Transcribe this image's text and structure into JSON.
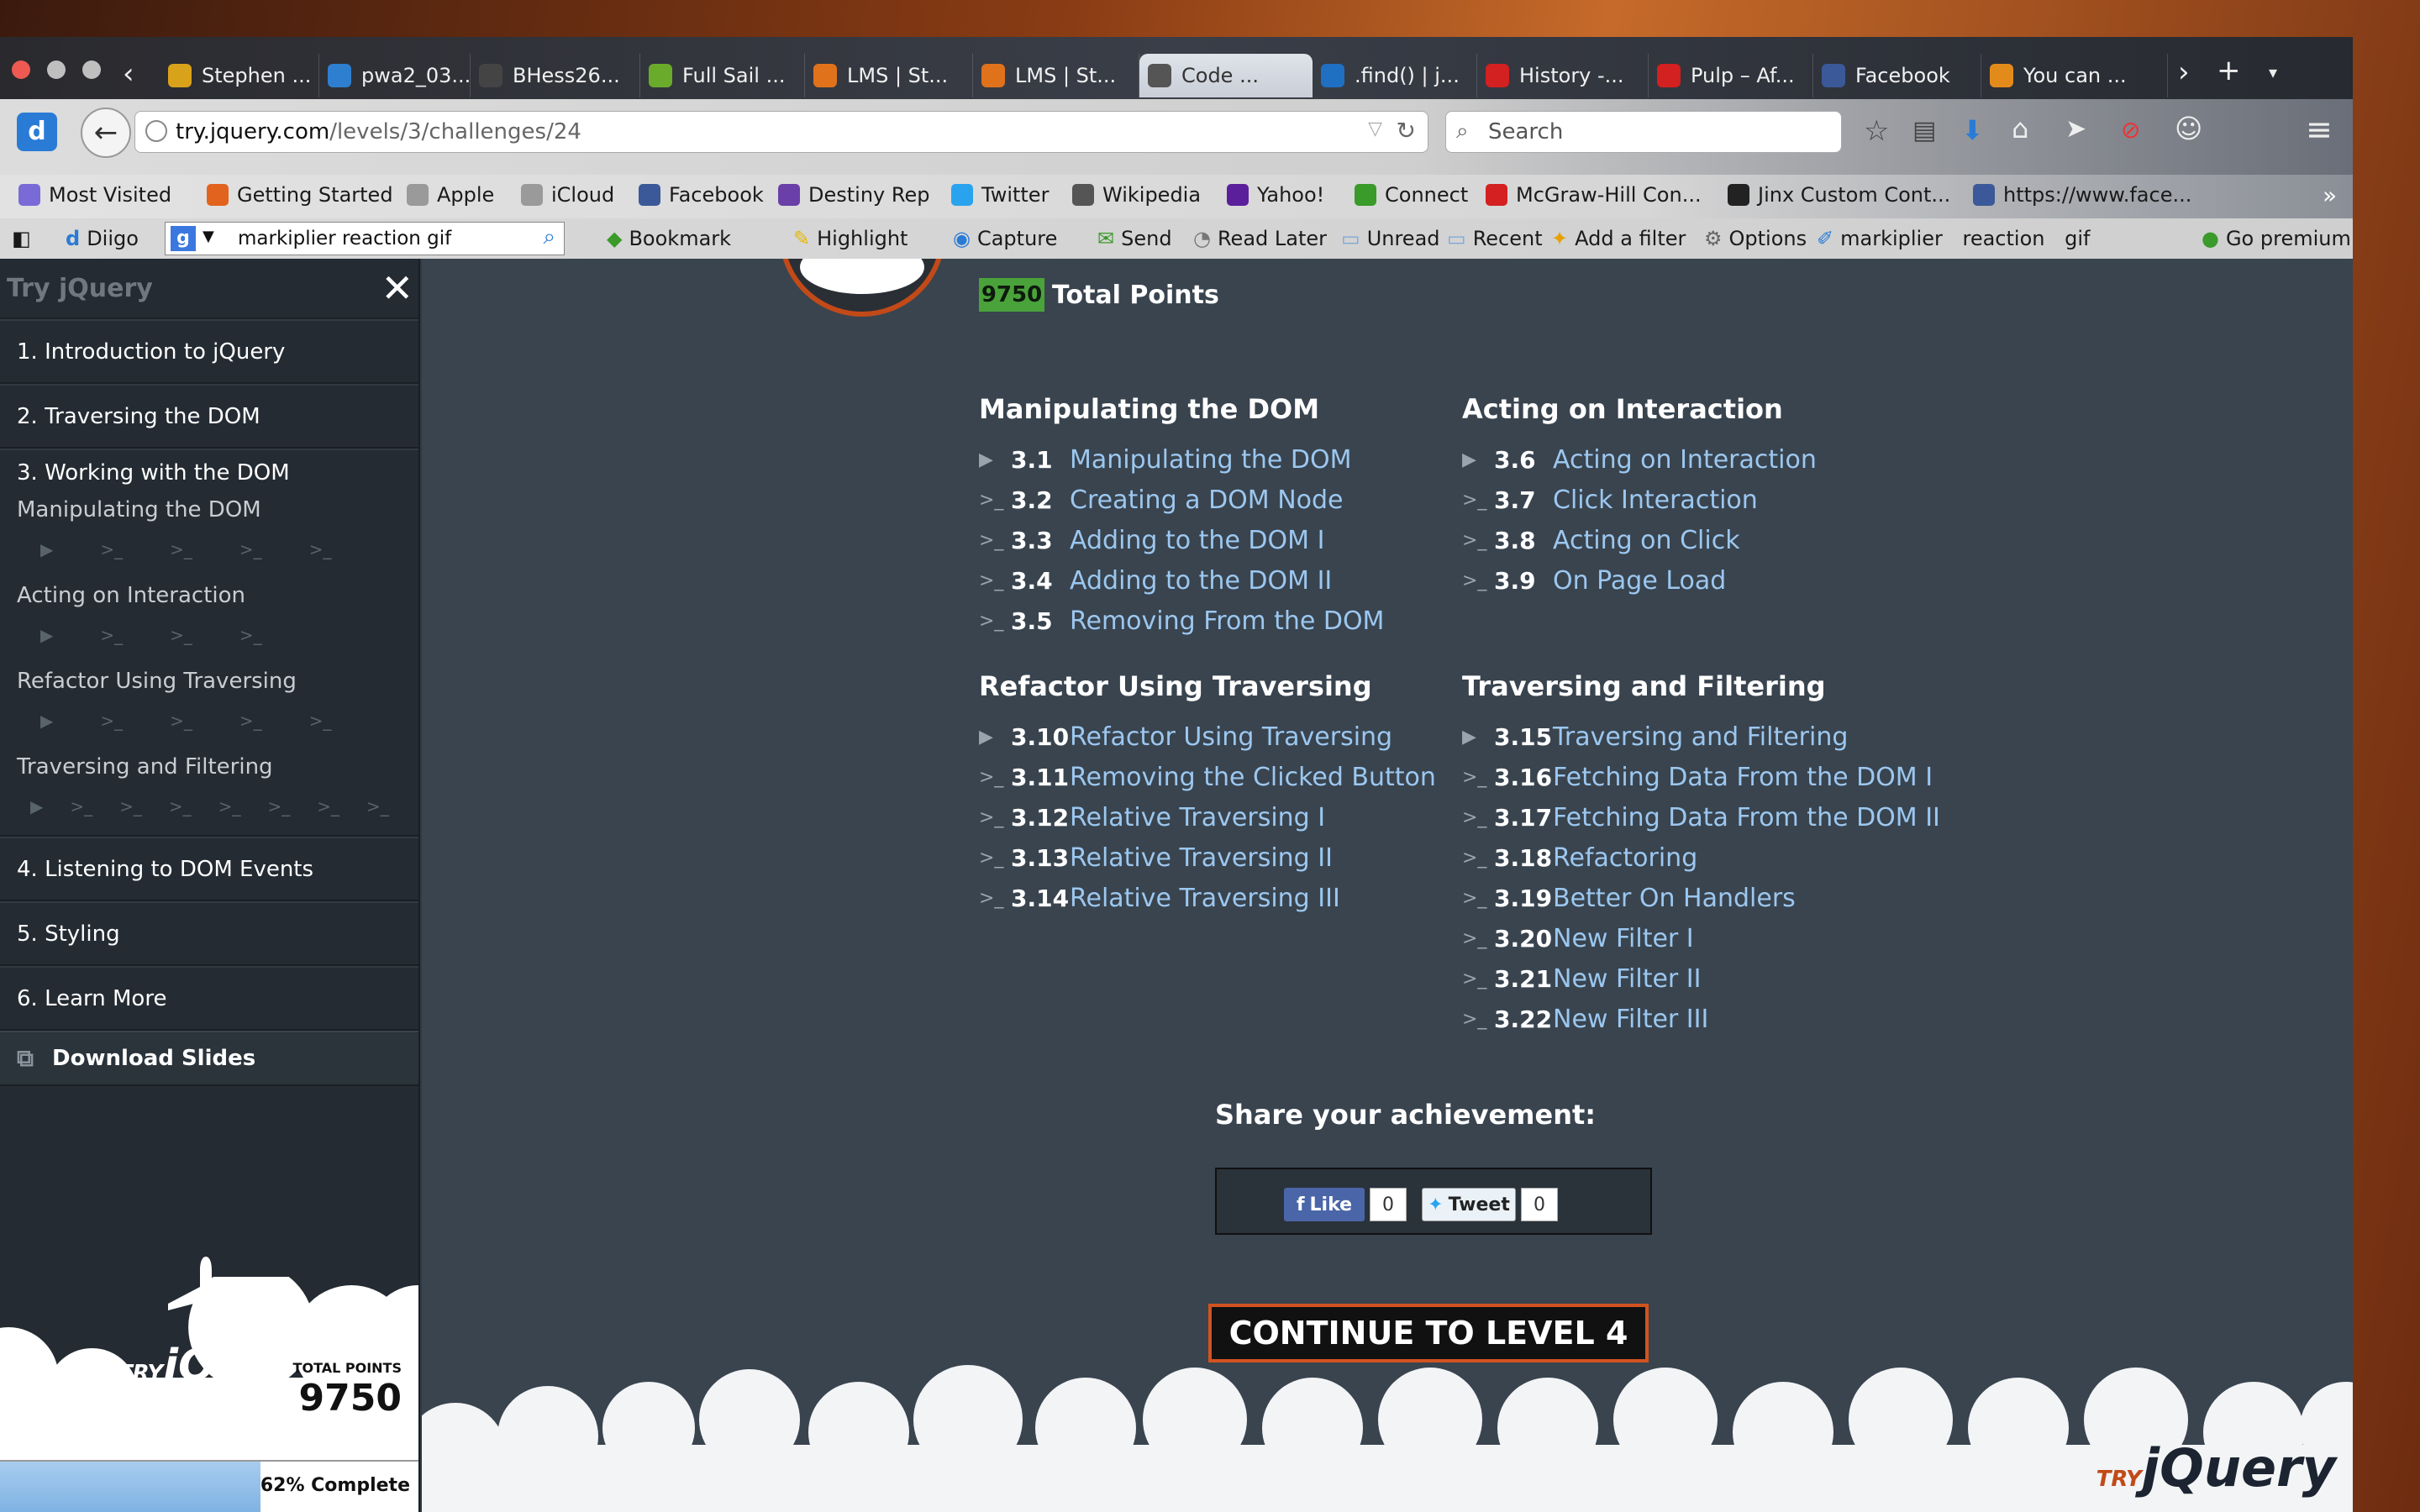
{
  "browser": {
    "tabs": [
      {
        "label": "Stephen ...",
        "icon": "b-icon",
        "color": "#d9a21b"
      },
      {
        "label": "pwa2_03...",
        "icon": "eye-icon",
        "color": "#2e7fd0"
      },
      {
        "label": "BHess26...",
        "icon": "github-icon",
        "color": "#444444"
      },
      {
        "label": "Full Sail ...",
        "icon": "fullsail-icon",
        "color": "#6bab2c"
      },
      {
        "label": "LMS | St...",
        "icon": "lms-icon",
        "color": "#e0721c"
      },
      {
        "label": "LMS | St...",
        "icon": "lms-icon",
        "color": "#e0721c"
      },
      {
        "label": "Code ...",
        "icon": "code-icon",
        "color": "#555555"
      },
      {
        "label": ".find() | j...",
        "icon": "jquery-icon",
        "color": "#1f6fc2"
      },
      {
        "label": "History -...",
        "icon": "youtube-icon",
        "color": "#d32020"
      },
      {
        "label": "Pulp – Af...",
        "icon": "youtube-icon",
        "color": "#d32020"
      },
      {
        "label": "Facebook",
        "icon": "facebook-icon",
        "color": "#3b5998"
      },
      {
        "label": "You can ...",
        "icon": "up-icon",
        "color": "#e38b1a"
      }
    ],
    "url_domain": "try.jquery.com",
    "url_path": "/levels/3/challenges/24",
    "search_placeholder": "Search",
    "bookmarks": [
      {
        "label": "Most Visited",
        "color": "#7a6ad8"
      },
      {
        "label": "Getting Started",
        "color": "#e2631d"
      },
      {
        "label": "Apple",
        "color": "#9a9a9a"
      },
      {
        "label": "iCloud",
        "color": "#9a9a9a"
      },
      {
        "label": "Facebook",
        "color": "#3b5998"
      },
      {
        "label": "Destiny Rep",
        "color": "#6a3fa8"
      },
      {
        "label": "Twitter",
        "color": "#2aa3ef"
      },
      {
        "label": "Wikipedia",
        "color": "#555555"
      },
      {
        "label": "Yahoo!",
        "color": "#5b1f9c"
      },
      {
        "label": "Connect",
        "color": "#3a9a2a"
      },
      {
        "label": "McGraw-Hill Con...",
        "color": "#d42020"
      },
      {
        "label": "Jinx Custom Cont...",
        "color": "#222222"
      },
      {
        "label": "https://www.face...",
        "color": "#3b5998"
      }
    ],
    "toolbar": {
      "diigo": "Diigo",
      "diigo_search": "markiplier reaction gif",
      "bookmark": "Bookmark",
      "highlight": "Highlight",
      "capture": "Capture",
      "send": "Send",
      "read_later": "Read Later",
      "unread": "Unread",
      "recent": "Recent",
      "add_filter": "Add a filter",
      "options": "Options",
      "term1": "markiplier",
      "term2": "reaction",
      "term3": "gif",
      "premium": "Go premium!"
    }
  },
  "sidebar": {
    "title": "Try jQuery",
    "levels": [
      "1. Introduction to jQuery",
      "2. Traversing the DOM",
      "3. Working with the DOM",
      "4. Listening to DOM Events",
      "5. Styling",
      "6. Learn More"
    ],
    "sections": [
      {
        "name": "Manipulating the DOM",
        "count": 5
      },
      {
        "name": "Acting on Interaction",
        "count": 4
      },
      {
        "name": "Refactor Using Traversing",
        "count": 5
      },
      {
        "name": "Traversing and Filtering",
        "count": 8
      }
    ],
    "download": "Download Slides",
    "total_points_label": "TOTAL POINTS",
    "total_points": "9750",
    "progress_text": "62% Complete",
    "progress": 0.62,
    "logo_try": "TRY",
    "logo_main": "jQuery"
  },
  "main": {
    "points_badge": "9750",
    "points_label": "Total Points",
    "sections": [
      {
        "title": "Manipulating the DOM",
        "items": [
          {
            "num": "3.1",
            "label": "Manipulating the DOM",
            "icon": "play-icon"
          },
          {
            "num": "3.2",
            "label": "Creating a DOM Node",
            "icon": "prompt-icon"
          },
          {
            "num": "3.3",
            "label": "Adding to the DOM I",
            "icon": "prompt-icon"
          },
          {
            "num": "3.4",
            "label": "Adding to the DOM II",
            "icon": "prompt-icon"
          },
          {
            "num": "3.5",
            "label": "Removing From the DOM",
            "icon": "prompt-icon"
          }
        ]
      },
      {
        "title": "Acting on Interaction",
        "items": [
          {
            "num": "3.6",
            "label": "Acting on Interaction",
            "icon": "play-icon"
          },
          {
            "num": "3.7",
            "label": "Click Interaction",
            "icon": "prompt-icon"
          },
          {
            "num": "3.8",
            "label": "Acting on Click",
            "icon": "prompt-icon"
          },
          {
            "num": "3.9",
            "label": "On Page Load",
            "icon": "prompt-icon"
          }
        ]
      },
      {
        "title": "Refactor Using Traversing",
        "items": [
          {
            "num": "3.10",
            "label": "Refactor Using Traversing",
            "icon": "play-icon"
          },
          {
            "num": "3.11",
            "label": "Removing the Clicked Button",
            "icon": "prompt-icon"
          },
          {
            "num": "3.12",
            "label": "Relative Traversing I",
            "icon": "prompt-icon"
          },
          {
            "num": "3.13",
            "label": "Relative Traversing II",
            "icon": "prompt-icon"
          },
          {
            "num": "3.14",
            "label": "Relative Traversing III",
            "icon": "prompt-icon"
          }
        ]
      },
      {
        "title": "Traversing and Filtering",
        "items": [
          {
            "num": "3.15",
            "label": "Traversing and Filtering",
            "icon": "play-icon"
          },
          {
            "num": "3.16",
            "label": "Fetching Data From the DOM I",
            "icon": "prompt-icon"
          },
          {
            "num": "3.17",
            "label": "Fetching Data From the DOM II",
            "icon": "prompt-icon"
          },
          {
            "num": "3.18",
            "label": "Refactoring",
            "icon": "prompt-icon"
          },
          {
            "num": "3.19",
            "label": "Better On Handlers",
            "icon": "prompt-icon"
          },
          {
            "num": "3.20",
            "label": "New Filter I",
            "icon": "prompt-icon"
          },
          {
            "num": "3.21",
            "label": "New Filter II",
            "icon": "prompt-icon"
          },
          {
            "num": "3.22",
            "label": "New Filter III",
            "icon": "prompt-icon"
          }
        ]
      }
    ],
    "share_title": "Share your achievement:",
    "like_label": "Like",
    "like_count": "0",
    "tweet_label": "Tweet",
    "tweet_count": "0",
    "continue_label": "CONTINUE TO LEVEL 4",
    "logo_try": "TRY",
    "logo_main": "jQuery"
  },
  "colors": {
    "accent": "#d2531f",
    "link": "#9cc7ef",
    "badge": "#4aa33a"
  }
}
